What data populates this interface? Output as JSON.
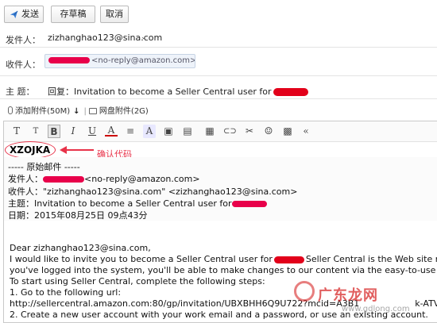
{
  "toolbar": {
    "send_label": "发送",
    "draft_label": "存草稿",
    "cancel_label": "取消"
  },
  "from": {
    "label": "发件人：",
    "value": "zizhanghao123@sina.com"
  },
  "to": {
    "label": "收件人：",
    "value": "<no-reply@amazon.com>"
  },
  "subject": {
    "label": "主    题：",
    "value": "回复：Invitation to become a Seller Central user for"
  },
  "attach": {
    "attach_label": "添加附件(50M)",
    "netdisk_label": "网盘附件(2G)"
  },
  "editor": {
    "tools": [
      "T",
      "T",
      "B",
      "I",
      "U",
      "A",
      "≡",
      "A",
      "▣",
      "▤",
      "▦",
      "⊂⊃",
      "✂",
      "☺",
      "▩",
      "«"
    ],
    "code": "XZOJKA",
    "annotation": "确认代码",
    "quote": {
      "header": "----- 原始邮件 -----",
      "from_label": "发件人：",
      "from_value": "<no-reply@amazon.com>",
      "to_label": "收件人：",
      "to_value": "\"zizhanghao123@sina.com\" <zizhanghao123@sina.com>",
      "subject_label": "主题：",
      "subject_value": "Invitation to become a Seller Central user for",
      "date_label": "日期：",
      "date_value": "2015年08月25日 09点43分"
    },
    "body": [
      "Dear zizhanghao123@sina.com,",
      "I would like to invite you to become a Seller Central user for",
      "Seller Central is the Web site manager",
      "you've logged into the system, you'll be able to make changes to our content via the easy-to-use Seller Cen",
      "To start using Seller Central, complete the following steps:",
      "1. Go to the following url:",
      "http://sellercentral.amazon.com:80/gp/invitation/UBXBHH6Q9U722?mcid=A3B1",
      "k-ATVP",
      "2. Create a new user account with your work email and a password, or use an existing",
      "account."
    ]
  },
  "watermark": {
    "text": "广东龙网",
    "sub": "www.gdlong.com"
  }
}
